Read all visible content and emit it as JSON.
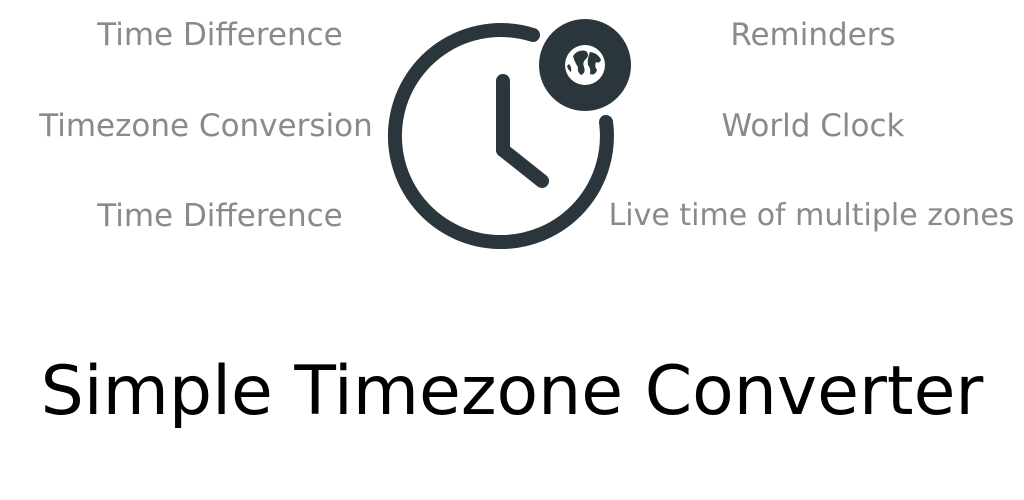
{
  "features": {
    "left": [
      "Time Difference",
      "Timezone Conversion",
      "Time Difference"
    ],
    "right": [
      "Reminders",
      "World Clock",
      "Live time of multiple zones"
    ]
  },
  "app": {
    "title": "Simple Timezone Converter"
  },
  "icons": {
    "main": "clock-icon",
    "badge": "globe-icon"
  },
  "colors": {
    "feature_text": "#8a8a8a",
    "icon": "#2b363c",
    "title_text": "#000000"
  }
}
